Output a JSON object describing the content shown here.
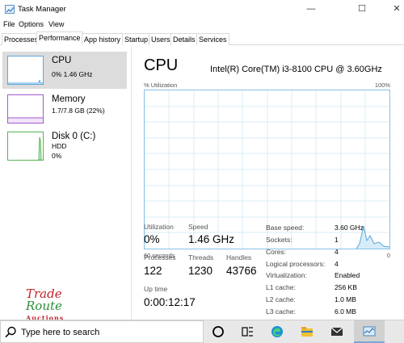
{
  "window": {
    "title": "Task Manager",
    "minimize": "—",
    "maximize": "☐",
    "close": "✕"
  },
  "menu": [
    "File",
    "Options",
    "View"
  ],
  "tabs": [
    "Processes",
    "Performance",
    "App history",
    "Startup",
    "Users",
    "Details",
    "Services"
  ],
  "active_tab": "Performance",
  "resources": [
    {
      "name": "CPU",
      "sub1": "0%  1.46 GHz",
      "sub2": "",
      "color": "#5aa8dc"
    },
    {
      "name": "Memory",
      "sub1": "1.7/7.8 GB (22%)",
      "sub2": "",
      "color": "#a45ad1"
    },
    {
      "name": "Disk 0 (C:)",
      "sub1": "HDD",
      "sub2": "0%",
      "color": "#56b456"
    }
  ],
  "main": {
    "title": "CPU",
    "model": "Intel(R) Core(TM) i3-8100 CPU @ 3.60GHz",
    "util_label": "% Utilization",
    "util_max": "100%",
    "axis_left": "60 seconds",
    "axis_right": "0",
    "graph_color": "#5aa8dc",
    "stats": {
      "utilization_label": "Utilization",
      "utilization": "0%",
      "speed_label": "Speed",
      "speed": "1.46 GHz",
      "processes_label": "Processes",
      "processes": "122",
      "threads_label": "Threads",
      "threads": "1230",
      "handles_label": "Handles",
      "handles": "43766",
      "uptime_label": "Up time",
      "uptime": "0:00:12:17"
    },
    "specs": [
      {
        "label": "Base speed:",
        "value": "3.60 GHz"
      },
      {
        "label": "Sockets:",
        "value": "1"
      },
      {
        "label": "Cores:",
        "value": "4"
      },
      {
        "label": "Logical processors:",
        "value": "4"
      },
      {
        "label": "Virtualization:",
        "value": "Enabled"
      },
      {
        "label": "L1 cache:",
        "value": "256 KB"
      },
      {
        "label": "L2 cache:",
        "value": "1.0 MB"
      },
      {
        "label": "L3 cache:",
        "value": "6.0 MB"
      }
    ]
  },
  "logo": {
    "line1": "Trade",
    "line2": "Route",
    "line3": "Auctions"
  },
  "taskbar": {
    "search_placeholder": "Type here to search",
    "icons": [
      "cortana-circle-icon",
      "task-view-icon",
      "edge-icon",
      "file-explorer-icon",
      "mail-icon",
      "task-manager-icon"
    ]
  }
}
